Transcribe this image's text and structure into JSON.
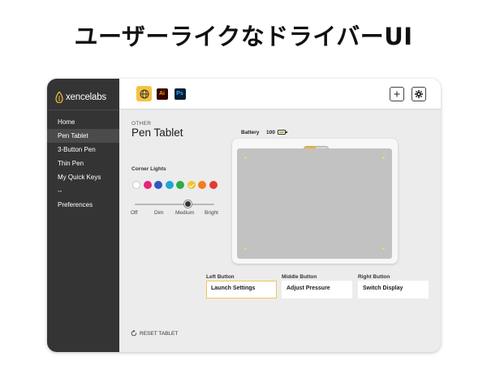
{
  "headline": "ユーザーライクなドライバーUI",
  "app": {
    "logo_text": "xencelabs",
    "brand_color": "#f5c241"
  },
  "sidebar": {
    "items": [
      {
        "label": "Home",
        "active": false
      },
      {
        "label": "Pen Tablet",
        "active": true
      },
      {
        "label": "3-Button Pen",
        "active": false
      },
      {
        "label": "Thin Pen",
        "active": false
      },
      {
        "label": "My Quick Keys",
        "active": false
      },
      {
        "label": "--",
        "active": false
      },
      {
        "label": "Preferences",
        "active": false
      }
    ]
  },
  "toolbar": {
    "app_tabs": [
      {
        "name": "globe-icon",
        "label": "",
        "active": true
      },
      {
        "name": "illustrator-icon",
        "label": "Ai",
        "active": false
      },
      {
        "name": "photoshop-icon",
        "label": "Ps",
        "active": false
      }
    ],
    "add_icon": "plus-icon",
    "settings_icon": "gear-icon"
  },
  "main": {
    "category": "OTHER",
    "title": "Pen Tablet",
    "battery": {
      "label": "Battery",
      "value": "100",
      "level": 1.0
    },
    "corner_lights": {
      "label": "Corner Lights",
      "colors": [
        "#ffffff",
        "#e8227a",
        "#2f56c4",
        "#1ea6d8",
        "#2bac48",
        "#f2c233",
        "#f47b20",
        "#e53a2e"
      ],
      "selected_index": 5,
      "brightness_options": [
        "Off",
        "Dim",
        "Medium",
        "Bright"
      ],
      "brightness_selected": "Medium"
    },
    "buttons": [
      {
        "label": "Left Button",
        "value": "Launch Settings",
        "focused": true
      },
      {
        "label": "Middle Button",
        "value": "Adjust Pressure",
        "focused": false
      },
      {
        "label": "Right Button",
        "value": "Switch Display",
        "focused": false
      }
    ],
    "reset_label": "RESET TABLET"
  }
}
